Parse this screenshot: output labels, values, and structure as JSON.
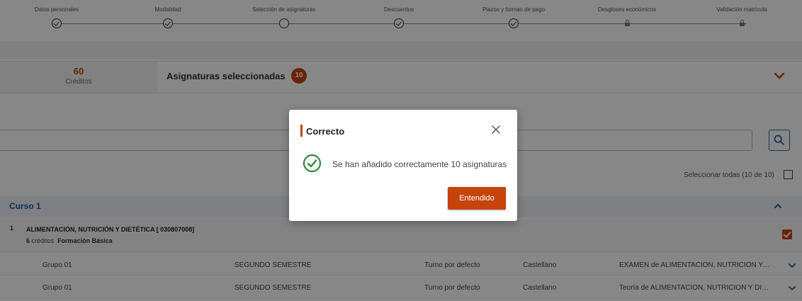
{
  "stepper": {
    "steps": [
      {
        "label": "Datos personales",
        "state": "done"
      },
      {
        "label": "Modalidad",
        "state": "done"
      },
      {
        "label": "Selección de asignaturas",
        "state": "current"
      },
      {
        "label": "Descuentos",
        "state": "done"
      },
      {
        "label": "Plazos y formas de pago",
        "state": "done"
      },
      {
        "label": "Desgloses económicos",
        "state": "locked"
      },
      {
        "label": "Validación matrícula",
        "state": "locked"
      }
    ]
  },
  "summary": {
    "credits_value": "60",
    "credits_label": "Créditos",
    "selected_title": "Asignaturas seleccionadas",
    "selected_count": "10"
  },
  "search": {
    "placeholder": "",
    "button_icon": "search-icon"
  },
  "select_all_label": "Seleccionar todas (10 de 10)",
  "course": {
    "title": "Curso 1",
    "subject": {
      "index": "1",
      "name": "ALIMENTACIÓN, NUTRICIÓN Y DIETÉTICA [ 030807008]",
      "credits_value": "6",
      "credits_label": "créditos",
      "type": "Formación Básica",
      "checked": true
    },
    "groups": [
      {
        "name": "Grupo 01",
        "semester": "SEGUNDO SEMESTRE",
        "turn": "Turno por defecto",
        "language": "Castellano",
        "description": "EXAMEN de ALIMENTACION, NUTRICION Y DI..."
      },
      {
        "name": "Grupo 01",
        "semester": "SEGUNDO SEMESTRE",
        "turn": "Turno por defecto",
        "language": "Castellano",
        "description": "Teoría de ALIMENTACION, NUTRICION Y DIET..."
      }
    ]
  },
  "modal": {
    "title": "Correcto",
    "message": "Se han añadido correctamente 10 asignaturas",
    "button_label": "Entendido"
  },
  "colors": {
    "accent": "#c6430c",
    "success": "#2e8b3a",
    "link_blue": "#1f5f9e"
  }
}
